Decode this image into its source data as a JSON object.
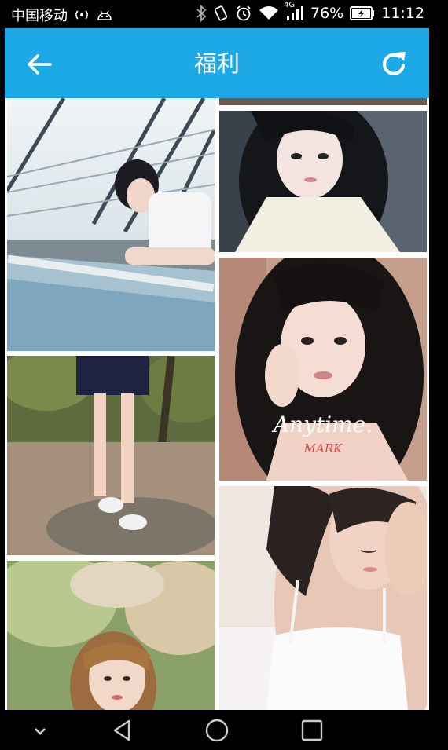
{
  "status_bar": {
    "carrier": "中国移动",
    "network": "4G",
    "battery": "76%",
    "time": "11:12"
  },
  "toolbar": {
    "title": "福利"
  },
  "gallery": {
    "watermark_script": "Anytime.",
    "watermark_brand": "MARK"
  },
  "icons": [
    "back-arrow-icon",
    "refresh-icon",
    "hotspot-icon",
    "android-icon",
    "bluetooth-icon",
    "vibrate-icon",
    "alarm-icon",
    "wifi-icon",
    "signal-icon",
    "battery-icon",
    "chevron-down-icon",
    "back-triangle-icon",
    "home-circle-icon",
    "recents-square-icon"
  ]
}
